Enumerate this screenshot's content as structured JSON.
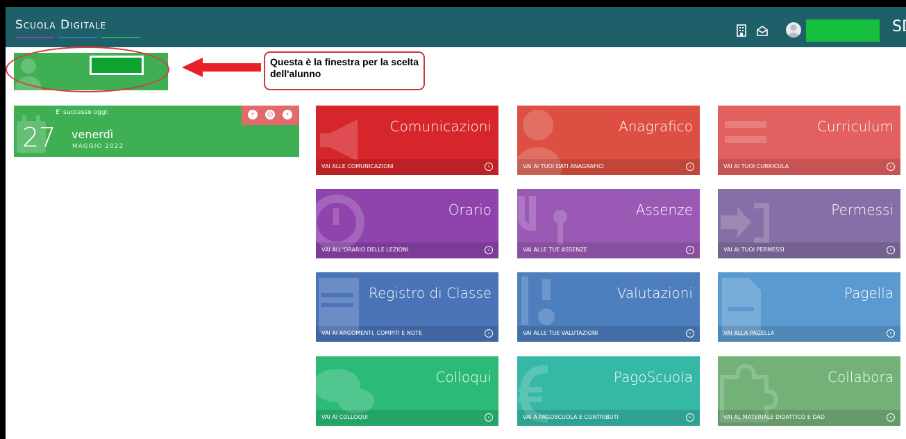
{
  "header": {
    "logo_text": "Scuola Digitale",
    "brand_short": "SD",
    "colors": {
      "bar": "#1e5f6a",
      "user_highlight": "#17c03c"
    },
    "logo_underline_colors": [
      "#8e44ad",
      "#2980b9",
      "#27ae60"
    ],
    "icons": [
      "building-icon",
      "envelope-open-icon",
      "avatar-icon"
    ]
  },
  "annotation": {
    "callout_text": "Questa è la finestra per la scelta dell'alunno"
  },
  "date_widget": {
    "title": "E' successo oggi:",
    "day": "27",
    "weekday": "venerdì",
    "month_year": "MAGGIO 2022",
    "nav_icons": [
      "arrow-left-icon",
      "target-icon",
      "arrow-right-icon"
    ]
  },
  "tiles": [
    {
      "title": "Comunicazioni",
      "footer": "VAI ALLE COMUNICAZIONI",
      "color": "#d6262b",
      "icon": "megaphone-icon"
    },
    {
      "title": "Anagrafico",
      "footer": "VAI AI TUOI DATI ANAGRAFICI",
      "color": "#dd4f42",
      "icon": "person-icon"
    },
    {
      "title": "Curriculum",
      "footer": "VAI AI TUOI CURRICULA",
      "color": "#e36060",
      "icon": "list-icon"
    },
    {
      "title": "Orario",
      "footer": "VAI ALL'ORARIO DELLE LEZIONI",
      "color": "#8f44ad",
      "icon": "clock-icon"
    },
    {
      "title": "Assenze",
      "footer": "VAI ALLE TUE ASSENZE",
      "color": "#9b59b6",
      "icon": "key-icon"
    },
    {
      "title": "Permessi",
      "footer": "VAI AI TUOI PERMESSI",
      "color": "#866fa6",
      "icon": "sign-in-icon"
    },
    {
      "title": "Registro di Classe",
      "footer": "VAI AI ARGOMENTI, COMPITI E NOTE",
      "color": "#4a73b8",
      "icon": "book-icon"
    },
    {
      "title": "Valutazioni",
      "footer": "VAI ALLE TUE VALUTAZIONI",
      "color": "#4d7fbf",
      "icon": "grades-icon"
    },
    {
      "title": "Pagella",
      "footer": "VAI ALLA PAGELLA",
      "color": "#5a9ad1",
      "icon": "document-icon"
    },
    {
      "title": "Colloqui",
      "footer": "VAI AI COLLOQUI",
      "color": "#2bbb76",
      "icon": "chat-icon"
    },
    {
      "title": "PagoScuola",
      "footer": "VAI A PAGOSCUOLA E CONTRIBUTI",
      "color": "#35b8a5",
      "icon": "euro-icon"
    },
    {
      "title": "Collabora",
      "footer": "VAI AL MATERIALE DIDATTICO E DAD",
      "color": "#73b179",
      "icon": "puzzle-icon"
    }
  ]
}
